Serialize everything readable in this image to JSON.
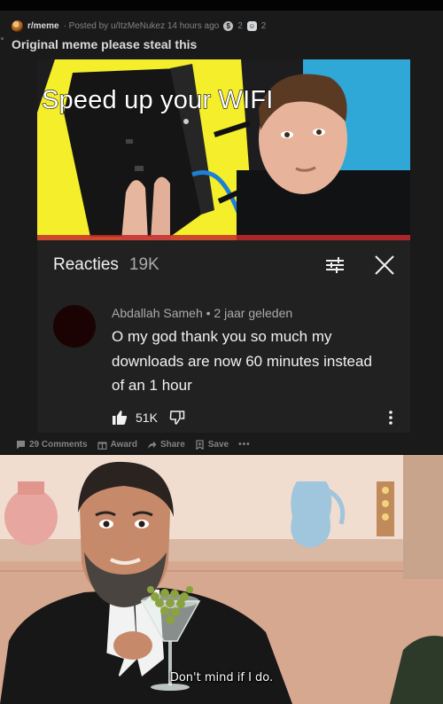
{
  "post": {
    "subreddit": "r/meme",
    "posted_by": "· Posted by u/ItzMeNukez 14 hours ago",
    "award_count_1": "2",
    "award_count_2": "2",
    "title": "Original meme please steal this",
    "footer": {
      "comments_label": "29 Comments",
      "award_label": "Award",
      "share_label": "Share",
      "save_label": "Save",
      "more_label": "•••"
    }
  },
  "screenshot": {
    "thumbnail_title": "Speed up your WIFI",
    "comments_header": "Reacties",
    "comments_count": "19K",
    "comment": {
      "author_line": "Abdallah Sameh • 2 jaar geleden",
      "text": "O my god thank you so much my downloads are now 60 minutes instead of an 1 hour",
      "likes": "51K"
    }
  },
  "meme_image": {
    "caption": "Don't mind if I do."
  },
  "colors": {
    "post_bg": "#1a1a1b",
    "card_bg": "#212121",
    "muted_text": "#818384",
    "thumb_yellow": "#f4ef2a"
  },
  "icons": [
    "award-silver-icon",
    "award-wholesome-icon",
    "filter-icon",
    "close-icon",
    "like-icon",
    "dislike-icon",
    "kebab-icon",
    "comment-icon",
    "gift-icon",
    "share-icon",
    "save-icon"
  ]
}
